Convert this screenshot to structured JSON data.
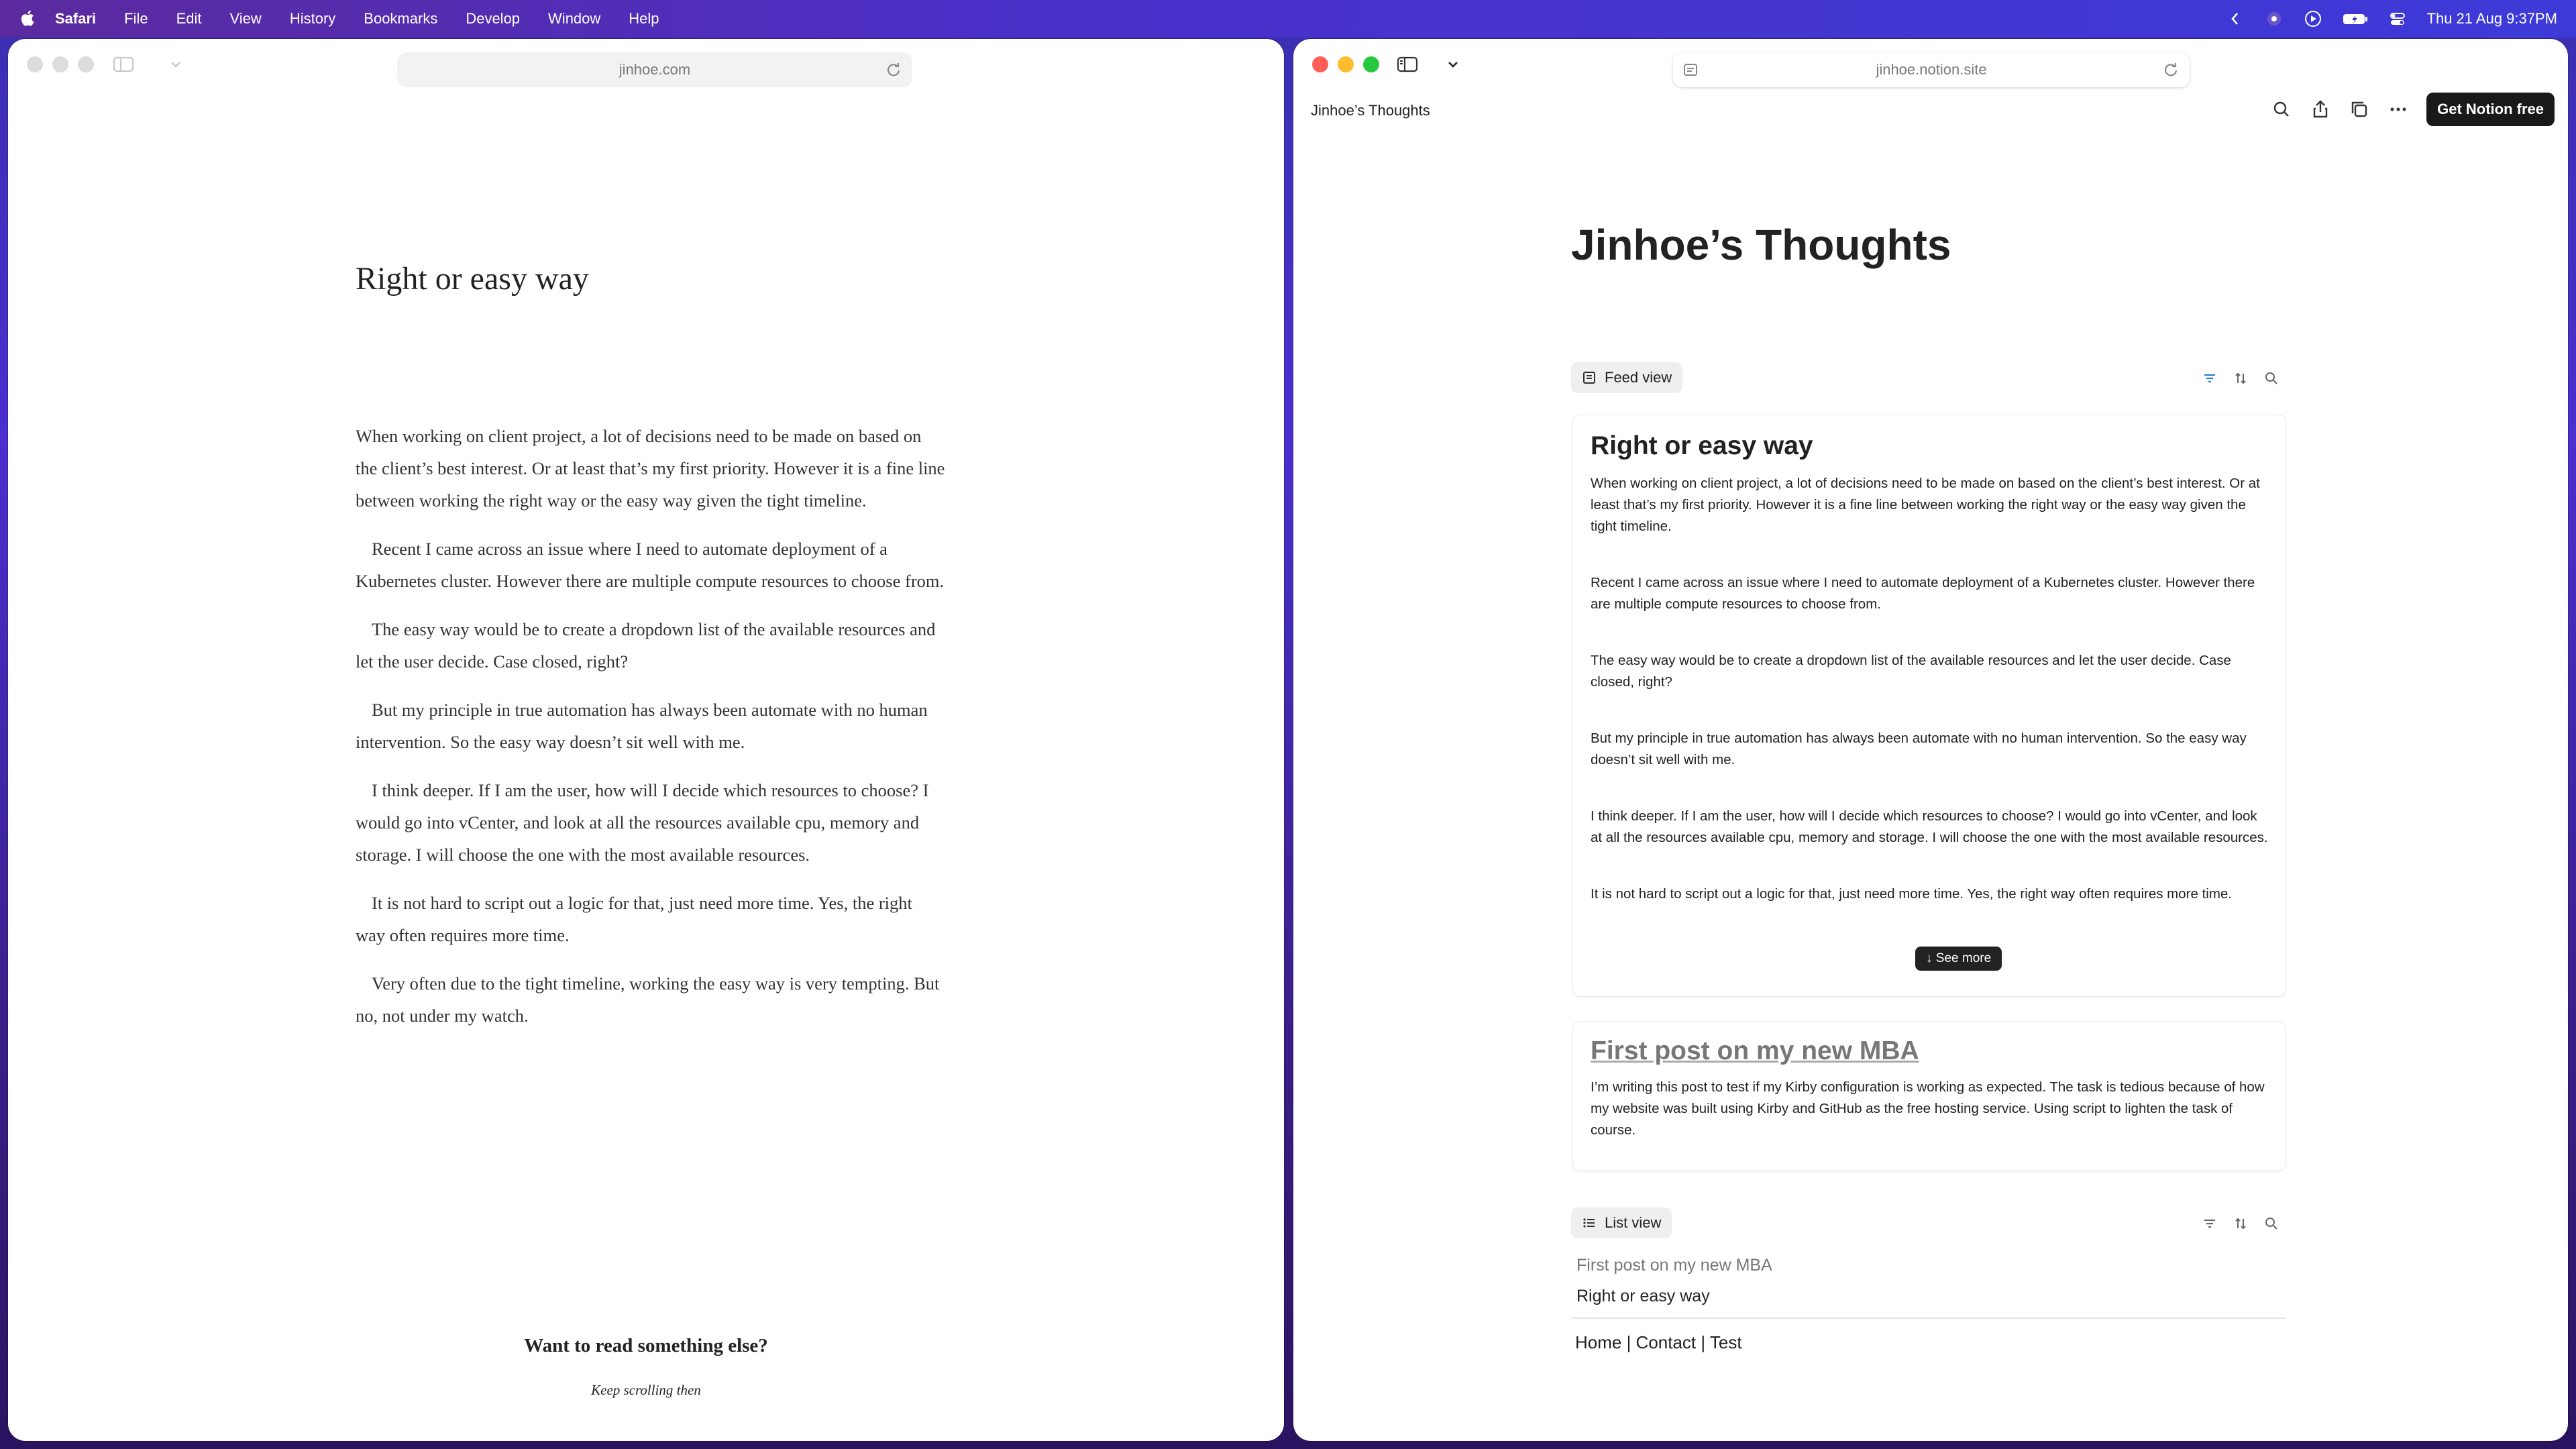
{
  "menubar": {
    "app": "Safari",
    "menus": [
      "File",
      "Edit",
      "View",
      "History",
      "Bookmarks",
      "Develop",
      "Window",
      "Help"
    ],
    "datetime": "Thu 21 Aug  9:37PM"
  },
  "left_window": {
    "url": "jinhoe.com",
    "article": {
      "title": "Right or easy way",
      "paragraphs": [
        "When working on client project, a lot of decisions need to be made on based on the client’s best interest. Or at least that’s my first priority. However it is a fine line between working the right way or the easy way given the tight timeline.",
        "Recent I came across an issue where I need to automate deployment of a Kubernetes cluster. However there are multiple compute resources to choose from.",
        "The easy way would be to create a dropdown list of the available resources and let the user decide. Case closed, right?",
        "But my principle in true automation has always been automate with no human intervention. So the easy way doesn’t sit well with me.",
        "I think deeper. If I am the user, how will I decide which resources to choose? I would go into vCenter, and look at all the resources available cpu, memory and storage. I will choose the one with the most available resources.",
        "It is not hard to script out a logic for that, just need more time. Yes, the right way often requires more time.",
        "Very often due to the tight timeline, working the easy way is very tempting. But no, not under my watch."
      ]
    },
    "more_heading": "Want to read something else?",
    "more_sub": "Keep scrolling then"
  },
  "right_window": {
    "url": "jinhoe.notion.site",
    "breadcrumb": "Jinhoe’s Thoughts",
    "cta": "Get Notion free",
    "page_title": "Jinhoe’s Thoughts",
    "feed_view_label": "Feed view",
    "list_view_label": "List view",
    "cards": [
      {
        "title": "Right or easy way",
        "paragraphs": [
          "When working on client project, a lot of decisions need to be made on based on the client’s best interest. Or at least that’s my first priority. However it is a fine line between working the right way or the easy way given the tight timeline.",
          "Recent I came across an issue where I need to automate deployment of a Kubernetes cluster. However there are multiple compute resources to choose from.",
          "The easy way would be to create a dropdown list of the available resources and let the user decide. Case closed, right?",
          "But my principle in true automation has always been automate with no human intervention. So the easy way doesn’t sit well with me.",
          "I think deeper. If I am the user, how will I decide which resources to choose? I would go into vCenter, and look at all the resources available cpu, memory and storage. I will choose the one with the most available resources.",
          "It is not hard to script out a logic for that, just need more time. Yes, the right way often requires more time."
        ],
        "see_more": "See more"
      },
      {
        "title": "First post on my new MBA",
        "paragraphs": [
          "I’m writing this post to test if my Kirby configuration is working as expected. The task is tedious because of how my website was built using Kirby and GitHub as the free hosting service. Using script to lighten the task of course."
        ]
      }
    ],
    "list_items": [
      "First post on my new MBA",
      "Right or easy way"
    ],
    "footer": "Home | Contact | Test"
  }
}
